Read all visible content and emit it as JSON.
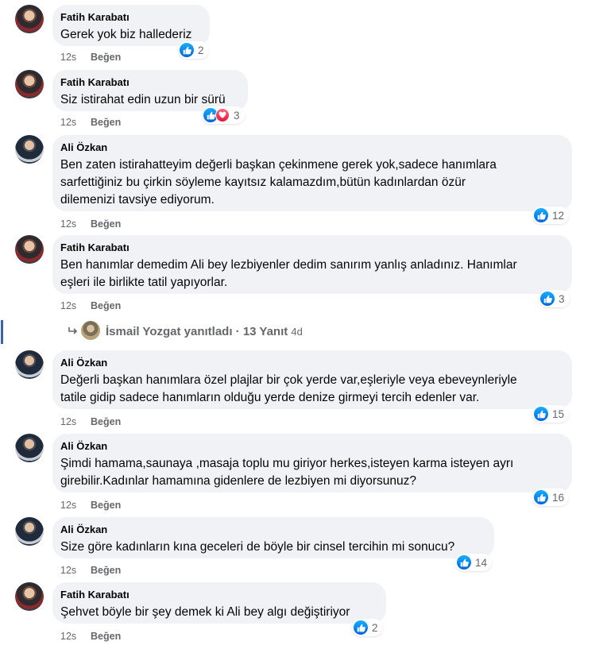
{
  "colors": {
    "like_blue": "#1877f2",
    "love_red": "#f33e58",
    "bubble_bg": "#f0f2f5",
    "meta_gray": "#65676b"
  },
  "comments": [
    {
      "author": "Fatih Karabatı",
      "avatar": "avatar-fatih",
      "lines": [
        "Gerek yok biz hallederiz"
      ],
      "time": "12s",
      "like_label": "Beğen",
      "reactions": [
        "like"
      ],
      "count": "2"
    },
    {
      "author": "Fatih Karabatı",
      "avatar": "avatar-fatih",
      "lines": [
        "Siz istirahat edin uzun bir sürü"
      ],
      "time": "12s",
      "like_label": "Beğen",
      "reactions": [
        "like",
        "love"
      ],
      "count": "3"
    },
    {
      "author": "Ali Özkan",
      "avatar": "avatar-ali",
      "lines": [
        "Ben zaten istirahatteyim değerli başkan çekinmene gerek yok,sadece hanımlara",
        "sarfettiğiniz bu çirkin söyleme kayıtsız kalamazdım,bütün kadınlardan özür",
        "dilemenizi tavsiye ediyorum."
      ],
      "time": "12s",
      "like_label": "Beğen",
      "reactions": [
        "like"
      ],
      "count": "12"
    },
    {
      "author": "Fatih Karabatı",
      "avatar": "avatar-fatih",
      "lines": [
        "Ben hanımlar demedim Ali bey lezbiyenler dedim sanırım yanlış anladınız. Hanımlar",
        "eşleri ile birlikte tatil yapıyorlar."
      ],
      "time": "12s",
      "like_label": "Beğen",
      "reactions": [
        "like"
      ],
      "count": "3"
    },
    {
      "author": "Ali Özkan",
      "avatar": "avatar-ali",
      "lines": [
        "Değerli başkan hanımlara özel plajlar bir çok yerde var,eşleriyle veya ebeveynleriyle",
        "tatile gidip sadece hanımların olduğu yerde denize girmeyi tercih edenler var."
      ],
      "time": "12s",
      "like_label": "Beğen",
      "reactions": [
        "like"
      ],
      "count": "15"
    },
    {
      "author": "Ali Özkan",
      "avatar": "avatar-ali",
      "lines": [
        "Şimdi hamama,saunaya ,masaja toplu mu giriyor herkes,isteyen karma isteyen ayrı",
        "girebilir.Kadınlar hamamına gidenlere de lezbiyen mi diyorsunuz?"
      ],
      "time": "12s",
      "like_label": "Beğen",
      "reactions": [
        "like"
      ],
      "count": "16"
    },
    {
      "author": "Ali Özkan",
      "avatar": "avatar-ali",
      "lines": [
        "Size göre kadınların kına geceleri de böyle bir cinsel tercihin mi sonucu?"
      ],
      "time": "12s",
      "like_label": "Beğen",
      "reactions": [
        "like"
      ],
      "count": "14"
    },
    {
      "author": "Fatih Karabatı",
      "avatar": "avatar-fatih",
      "lines": [
        "Şehvet böyle bir şey demek ki Ali bey algı değiştiriyor"
      ],
      "time": "12s",
      "like_label": "Beğen",
      "reactions": [
        "like"
      ],
      "count": "2"
    }
  ],
  "reply_thread": {
    "text": "İsmail Yozgat yanıtladı · 13 Yanıt",
    "age": "4d"
  }
}
